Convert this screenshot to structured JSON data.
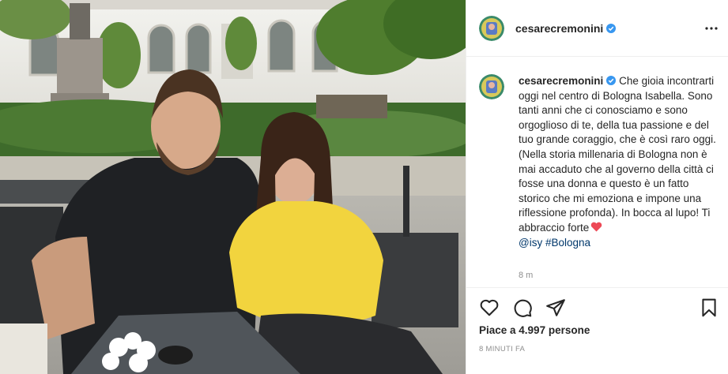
{
  "post": {
    "username": "cesarecremonini",
    "verified": true,
    "more_icon": "more-horizontal-icon",
    "caption_parts": {
      "p1": "Che gioia incontrarti oggi nel centro di Bologna Isabella. Sono tanti anni che ci conosciamo e sono orgoglioso di te, della tua passione e del tuo grande coraggio, che è così raro oggi.",
      "p2": "(Nella storia millenaria di Bologna non è mai accaduto che al governo della città ci fosse una donna e questo è un fatto storico che mi emoziona e impone una riflessione profonda). In bocca al lupo! Ti abbraccio forte",
      "mention": "@isy",
      "hashtag": "#Bologna"
    },
    "caption_time": "8 m",
    "likes_text": "Piace a 4.997 persone",
    "posted_ago": "8 MINUTI FA",
    "colors": {
      "verified_blue": "#3897f0",
      "heart_red": "#ed4956",
      "link_blue": "#00376b",
      "muted_gray": "#8e8e8e"
    },
    "icons": [
      "like-heart-icon",
      "comment-icon",
      "share-icon",
      "save-bookmark-icon",
      "verified-badge-icon",
      "heart-emoji-icon"
    ]
  }
}
